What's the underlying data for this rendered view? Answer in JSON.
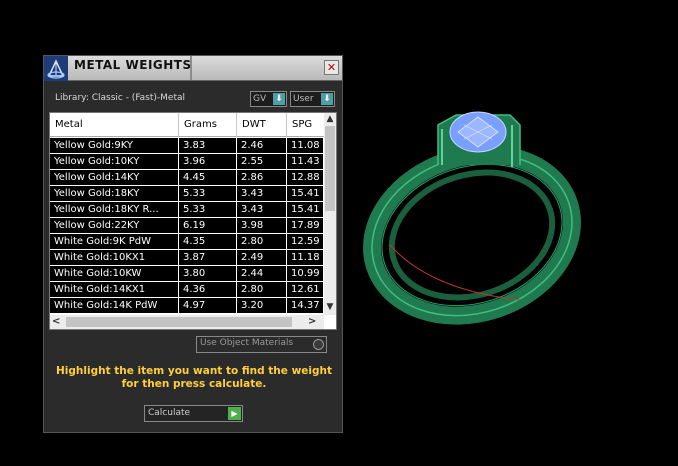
{
  "panel": {
    "title": "METAL WEIGHTS",
    "close_glyph": "✕",
    "library_label": "Library: Classic - (Fast)-Metal",
    "gv_dropdown": "GV",
    "user_dropdown": "User",
    "dropdown_arrow": "⬇",
    "table": {
      "headers": [
        "Metal",
        "Grams",
        "DWT",
        "SPG"
      ],
      "rows": [
        [
          "Yellow Gold:9KY",
          "3.83",
          "2.46",
          "11.08"
        ],
        [
          "Yellow Gold:10KY",
          "3.96",
          "2.55",
          "11.43"
        ],
        [
          "Yellow Gold:14KY",
          "4.45",
          "2.86",
          "12.88"
        ],
        [
          "Yellow Gold:18KY",
          "5.33",
          "3.43",
          "15.41"
        ],
        [
          "Yellow Gold:18KY R...",
          "5.33",
          "3.43",
          "15.41"
        ],
        [
          "Yellow Gold:22KY",
          "6.19",
          "3.98",
          "17.89"
        ],
        [
          "White Gold:9K PdW",
          "4.35",
          "2.80",
          "12.59"
        ],
        [
          "White Gold:10KX1",
          "3.87",
          "2.49",
          "11.18"
        ],
        [
          "White Gold:10KW",
          "3.80",
          "2.44",
          "10.99"
        ],
        [
          "White Gold:14KX1",
          "4.36",
          "2.80",
          "12.61"
        ],
        [
          "White Gold:14K PdW",
          "4.97",
          "3.20",
          "14.37"
        ]
      ]
    },
    "scroll": {
      "up": "▲",
      "down": "▼",
      "left": "<",
      "right": ">"
    },
    "use_object_materials": "Use Object Materials",
    "instruction": "Highlight the item you want to find the weight for then press calculate.",
    "calculate_label": "Calculate",
    "calculate_icon": "▶"
  },
  "colors": {
    "accent": "#4aa0a6",
    "instruction": "#ffcf3a",
    "calculate_play": "#4db04a",
    "ring_metal": "#1f7a4f",
    "gem": "#7aa0ff"
  },
  "icons": [
    "logo-icon",
    "close-icon",
    "dropdown-arrow-icon",
    "play-icon"
  ]
}
